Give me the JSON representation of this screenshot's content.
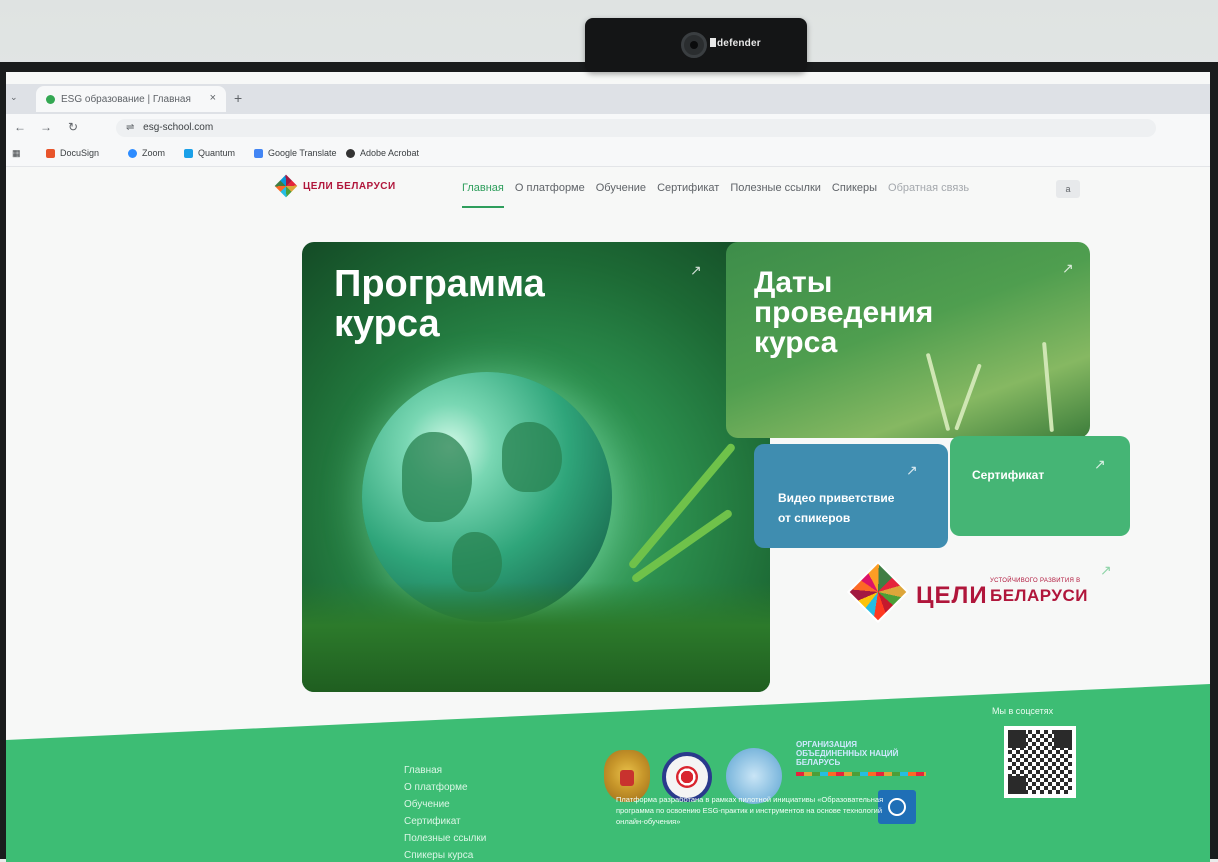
{
  "webcam": {
    "brand": "defender"
  },
  "browser": {
    "tab_title": "ESG образование | Главная",
    "tab_close": "×",
    "new_tab": "+",
    "url": "esg-school.com",
    "bookmarks": [
      {
        "label": "DocuSign",
        "color": "#e8542b"
      },
      {
        "label": "Zoom",
        "color": "#2d8cff"
      },
      {
        "label": "Quantum",
        "color": "#1aa0e8"
      },
      {
        "label": "Google Translate",
        "color": "#4285f4"
      },
      {
        "label": "Adobe Acrobat",
        "color": "#333333"
      }
    ]
  },
  "site": {
    "logo_text": "ЦЕЛИ БЕЛАРУСИ",
    "nav": [
      {
        "label": "Главная",
        "active": true
      },
      {
        "label": "О платформе"
      },
      {
        "label": "Обучение"
      },
      {
        "label": "Сертификат"
      },
      {
        "label": "Полезные ссылки"
      },
      {
        "label": "Спикеры"
      },
      {
        "label": "Обратная связь"
      }
    ],
    "search_label": "a",
    "cards": {
      "program": {
        "title_line1": "Программа",
        "title_line2": "курса",
        "arrow": "↗"
      },
      "dates": {
        "title_line1": "Даты",
        "title_line2": "проведения",
        "title_line3": "курса",
        "arrow": "↗"
      },
      "video": {
        "title_line1": "Видео приветствие",
        "title_line2": "от спикеров",
        "arrow": "↗"
      },
      "certificate": {
        "title": "Сертификат",
        "arrow": "↗"
      }
    },
    "sdg": {
      "main": "ЦЕЛИ",
      "sub_small": "УСТОЙЧИВОГО РАЗВИТИЯ В",
      "sub_big": "БЕЛАРУСИ",
      "arrow": "↗"
    },
    "footer": {
      "links": [
        "Главная",
        "О платформе",
        "Обучение",
        "Сертификат",
        "Полезные ссылки",
        "Спикеры курса"
      ],
      "un_text_line1": "ОРГАНИЗАЦИЯ",
      "un_text_line2": "ОБЪЕДИНЕННЫХ НАЦИЙ",
      "un_text_line3": "БЕЛАРУСЬ",
      "description": "Платформа разработана в рамках пилотной инициативы «Образовательная программа по освоению ESG-практик и инструментов на основе технологий онлайн-обучения»",
      "social_label": "Мы в соцсетях"
    }
  }
}
